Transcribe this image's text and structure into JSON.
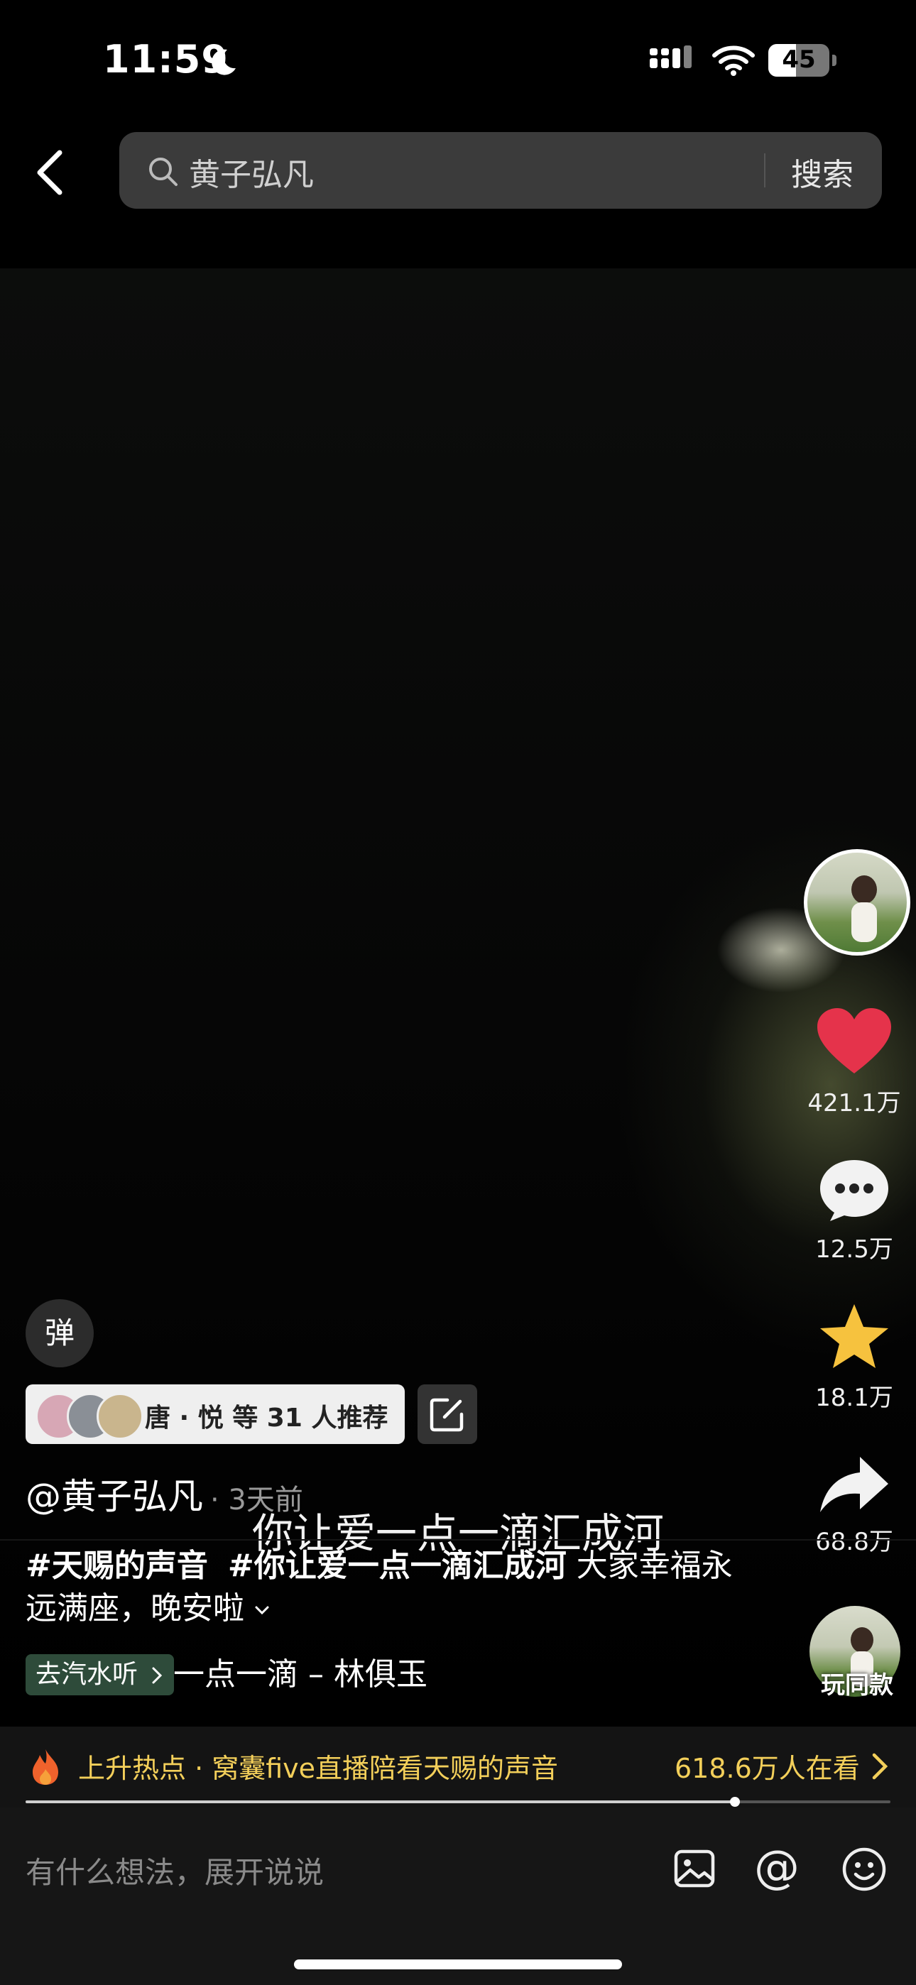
{
  "status_bar": {
    "time": "11:59",
    "battery": "45",
    "battery_level": 0.45
  },
  "search": {
    "query": "黄子弘凡",
    "button_label": "搜索"
  },
  "video": {
    "subtitle": "你让爱一点一滴汇成河",
    "progress": 0.82
  },
  "actions": {
    "likes": "421.1万",
    "comments": "12.5万",
    "favorites": "18.1万",
    "shares": "68.8万",
    "same_style_label": "玩同款"
  },
  "danmaku_label": "弹",
  "recommend": {
    "text": "唐 · 悦 等 31 人推荐"
  },
  "author": {
    "name": "@黄子弘凡",
    "time_ago": "· 3天前"
  },
  "description": {
    "tag1": "#天赐的声音",
    "tag2": "#你让爱一点一滴汇成河",
    "text": "大家幸福永远满座，晚安啦"
  },
  "music": {
    "tag_label": "去汽水听",
    "title": "一点一滴 – 林俱玉"
  },
  "hot": {
    "text": "上升热点 · 窝囊five直播陪看天赐的声音",
    "count": "618.6万人在看"
  },
  "comment_input": {
    "placeholder": "有什么想法，展开说说"
  },
  "colors": {
    "like_red": "#e5334b",
    "star_yellow": "#f6c23e",
    "hot_yellow": "#f3cf5a",
    "music_tag_bg": "#2e4b3a"
  }
}
